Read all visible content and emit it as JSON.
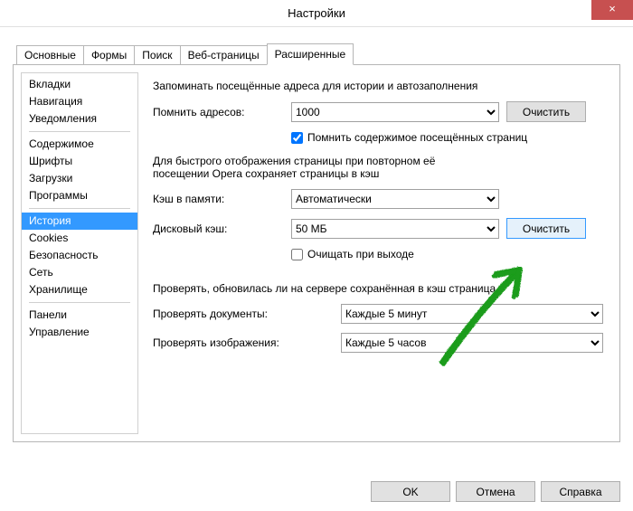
{
  "window": {
    "title": "Настройки",
    "close_glyph": "×"
  },
  "tabs": [
    "Основные",
    "Формы",
    "Поиск",
    "Веб-страницы",
    "Расширенные"
  ],
  "sidebar": {
    "groups": [
      [
        "Вкладки",
        "Навигация",
        "Уведомления"
      ],
      [
        "Содержимое",
        "Шрифты",
        "Загрузки",
        "Программы"
      ],
      [
        "История",
        "Cookies",
        "Безопасность",
        "Сеть",
        "Хранилище"
      ],
      [
        "Панели",
        "Управление"
      ]
    ],
    "selected": "История"
  },
  "content": {
    "intro": "Запоминать посещённые адреса для истории и автозаполнения",
    "remember_addr_label": "Помнить адресов:",
    "remember_addr_value": "1000",
    "clear_btn": "Очистить",
    "remember_content_cb": "Помнить содержимое посещённых страниц",
    "cache_intro1": "Для быстрого отображения страницы при повторном её",
    "cache_intro2": "посещении Opera сохраняет страницы в кэш",
    "mem_cache_label": "Кэш в памяти:",
    "mem_cache_value": "Автоматически",
    "disk_cache_label": "Дисковый кэш:",
    "disk_cache_value": "50 МБ",
    "clear_on_exit_cb": "Очищать при выходе",
    "verify_intro": "Проверять, обновилась ли на сервере сохранённая в кэш страница",
    "check_docs_label": "Проверять документы:",
    "check_docs_value": "Каждые 5 минут",
    "check_imgs_label": "Проверять изображения:",
    "check_imgs_value": "Каждые 5 часов"
  },
  "footer": {
    "ok": "OK",
    "cancel": "Отмена",
    "help": "Справка"
  }
}
